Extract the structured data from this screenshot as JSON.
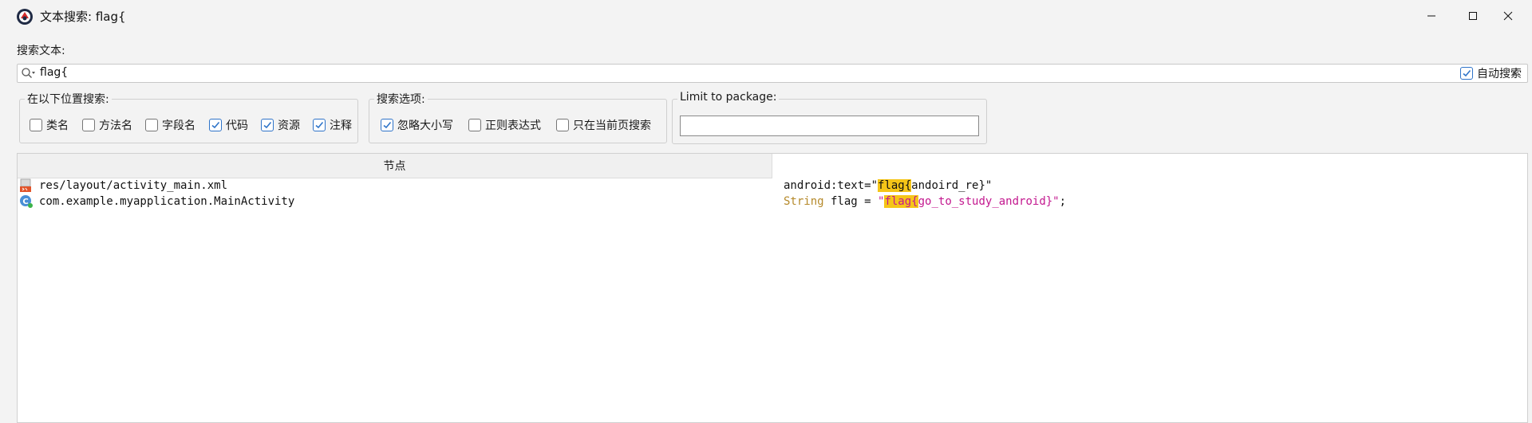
{
  "window": {
    "title": "文本搜索: flag{",
    "icon": "jadx-app-icon",
    "controls": [
      "minimize-icon",
      "maximize-icon",
      "close-icon"
    ]
  },
  "search": {
    "label": "搜索文本:",
    "value": "flag{",
    "auto_search_label": "自动搜索",
    "auto_search_checked": true
  },
  "search_in": {
    "title": "在以下位置搜索:",
    "options": [
      {
        "label": "类名",
        "checked": false
      },
      {
        "label": "方法名",
        "checked": false
      },
      {
        "label": "字段名",
        "checked": false
      },
      {
        "label": "代码",
        "checked": true
      },
      {
        "label": "资源",
        "checked": true
      },
      {
        "label": "注释",
        "checked": true
      }
    ]
  },
  "search_options": {
    "title": "搜索选项:",
    "options": [
      {
        "label": "忽略大小写",
        "checked": true
      },
      {
        "label": "正则表达式",
        "checked": false
      },
      {
        "label": "只在当前页搜索",
        "checked": false
      }
    ]
  },
  "package": {
    "title": "Limit to package:",
    "value": ""
  },
  "results": {
    "header_node": "节点",
    "rows": [
      {
        "icon": "xml-resource-icon",
        "node": "res/layout/activity_main.xml",
        "code_parts": [
          "android:text=\"",
          "flag{",
          "andoird_re}\""
        ]
      },
      {
        "icon": "class-icon",
        "node": "com.example.myapplication.MainActivity",
        "code_parts": [
          "String",
          " flag = ",
          "\"",
          "flag{",
          "go_to_study_android}\"",
          ";"
        ]
      }
    ]
  },
  "colors": {
    "highlight": "#f5c518",
    "keyword": "#b5892a",
    "string": "#c3188f",
    "checkbox_accent": "#2f74c9"
  }
}
